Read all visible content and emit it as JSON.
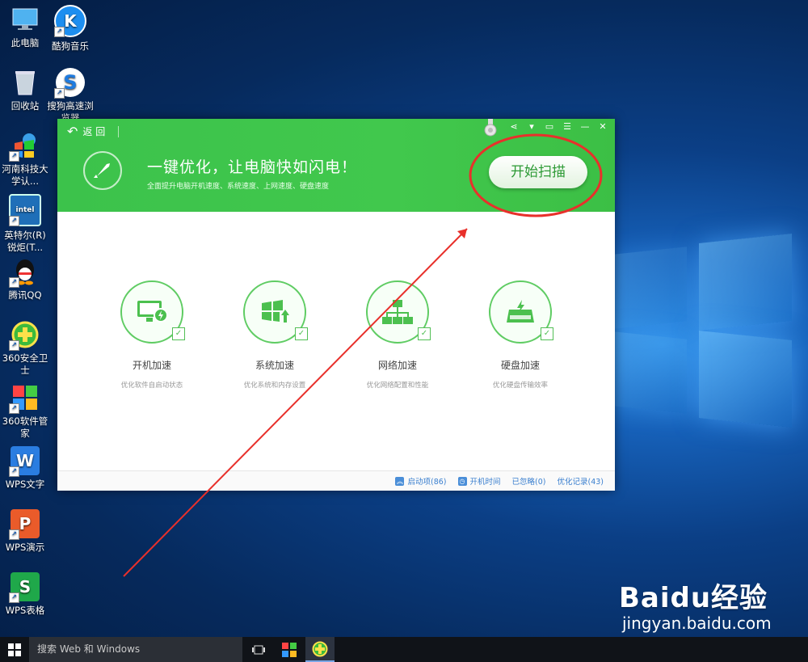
{
  "desktop": {
    "icons": [
      {
        "label": "此电脑",
        "icon": "computer-icon"
      },
      {
        "label": "酷狗音乐",
        "icon": "kugou-music-icon"
      },
      {
        "label": "回收站",
        "icon": "recycle-bin-icon"
      },
      {
        "label": "搜狗高速浏览器",
        "icon": "sogou-browser-icon"
      },
      {
        "label": "河南科技大学认...",
        "icon": "hn-university-icon"
      },
      {
        "label": "英特尔(R) 锐炬(T...",
        "icon": "intel-graphics-icon"
      },
      {
        "label": "腾讯QQ",
        "icon": "qq-icon"
      },
      {
        "label": "360安全卫士",
        "icon": "360-safe-icon"
      },
      {
        "label": "360软件管家",
        "icon": "360-software-icon"
      },
      {
        "label": "WPS文字",
        "icon": "wps-writer-icon"
      },
      {
        "label": "WPS演示",
        "icon": "wps-presentation-icon"
      },
      {
        "label": "WPS表格",
        "icon": "wps-spreadsheet-icon"
      }
    ]
  },
  "app": {
    "back_label": "返 回",
    "headline": "一键优化，让电脑快如闪电！",
    "subline": "全面提升电脑开机速度、系统速度、上网速度、硬盘速度",
    "scan_button": "开始扫描",
    "features": [
      {
        "name": "开机加速",
        "desc": "优化软件自启动状态",
        "icon": "monitor-bolt-icon"
      },
      {
        "name": "系统加速",
        "desc": "优化系统和内存设置",
        "icon": "windows-up-icon"
      },
      {
        "name": "网络加速",
        "desc": "优化网络配置和性能",
        "icon": "network-icon"
      },
      {
        "name": "硬盘加速",
        "desc": "优化硬盘传输效率",
        "icon": "harddisk-icon"
      }
    ],
    "footer": {
      "startup_items": "启动项(86)",
      "boot_time": "开机时间",
      "ignored": "已忽略(0)",
      "history": "优化记录(43)"
    },
    "colors": {
      "accent": "#3cc24b",
      "annotation": "#e8302b"
    }
  },
  "taskbar": {
    "search_placeholder": "搜索 Web 和 Windows"
  },
  "watermark": {
    "brand": "Baidu经验",
    "url": "jingyan.baidu.com"
  }
}
